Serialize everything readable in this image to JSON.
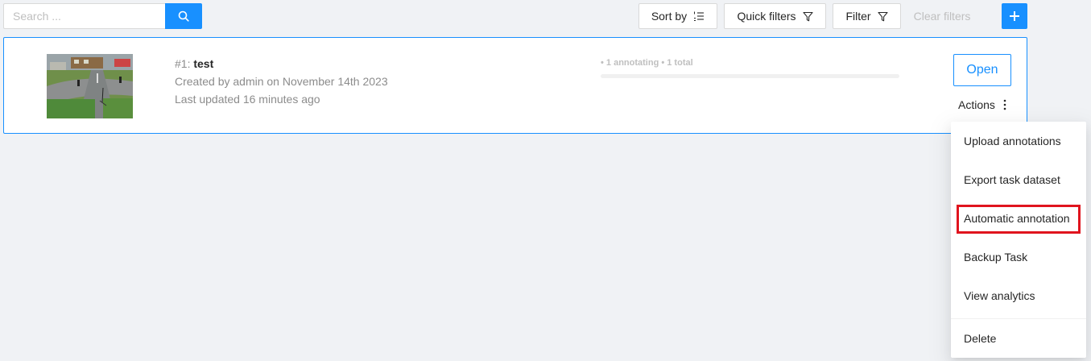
{
  "search": {
    "placeholder": "Search ..."
  },
  "toolbar": {
    "sort_label": "Sort by",
    "quick_filters_label": "Quick filters",
    "filter_label": "Filter",
    "clear_filters_label": "Clear filters"
  },
  "task": {
    "id_prefix": "#1: ",
    "name": "test",
    "created": "Created by admin on November 14th 2023",
    "updated": "Last updated 16 minutes ago",
    "progress_text": "• 1 annotating • 1 total",
    "progress_fraction": 0,
    "open_label": "Open",
    "actions_label": "Actions"
  },
  "menu": {
    "items": [
      {
        "label": "Upload annotations"
      },
      {
        "label": "Export task dataset"
      },
      {
        "label": "Automatic annotation"
      },
      {
        "label": "Backup Task"
      },
      {
        "label": "View analytics"
      },
      {
        "label": "Delete"
      }
    ]
  },
  "colors": {
    "accent": "#1890ff",
    "highlight": "#e0141e",
    "background": "#f0f2f5"
  }
}
